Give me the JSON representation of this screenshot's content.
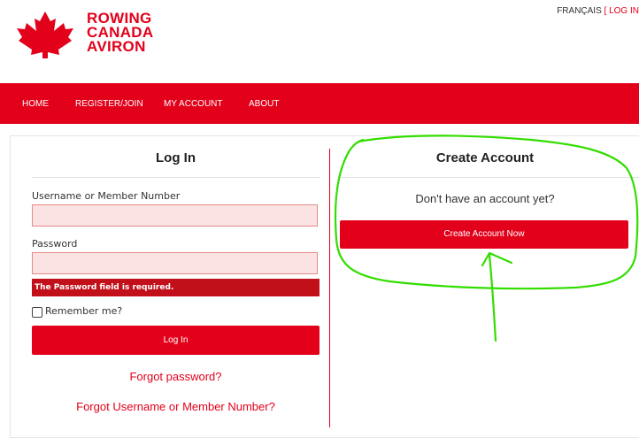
{
  "header": {
    "logo_lines": [
      "ROWING",
      "CANADA",
      "AVIRON"
    ],
    "lang_link": "FRANÇAIS",
    "lang_separator": " [ ",
    "login_link": "LOG IN"
  },
  "nav": {
    "items": [
      "HOME",
      "REGISTER/JOIN",
      "MY ACCOUNT",
      "ABOUT"
    ]
  },
  "login": {
    "title": "Log In",
    "username_label": "Username or Member Number",
    "password_label": "Password",
    "error_message": "The Password field is required.",
    "remember_label": "Remember me?",
    "submit_label": "Log In",
    "forgot_password": "Forgot password?",
    "forgot_username": "Forgot Username or Member Number?"
  },
  "create": {
    "title": "Create Account",
    "subtitle": "Don't have an account yet?",
    "button_label": "Create Account Now"
  },
  "colors": {
    "brand_red": "#e2001a",
    "annotation_green": "#33dd00"
  }
}
